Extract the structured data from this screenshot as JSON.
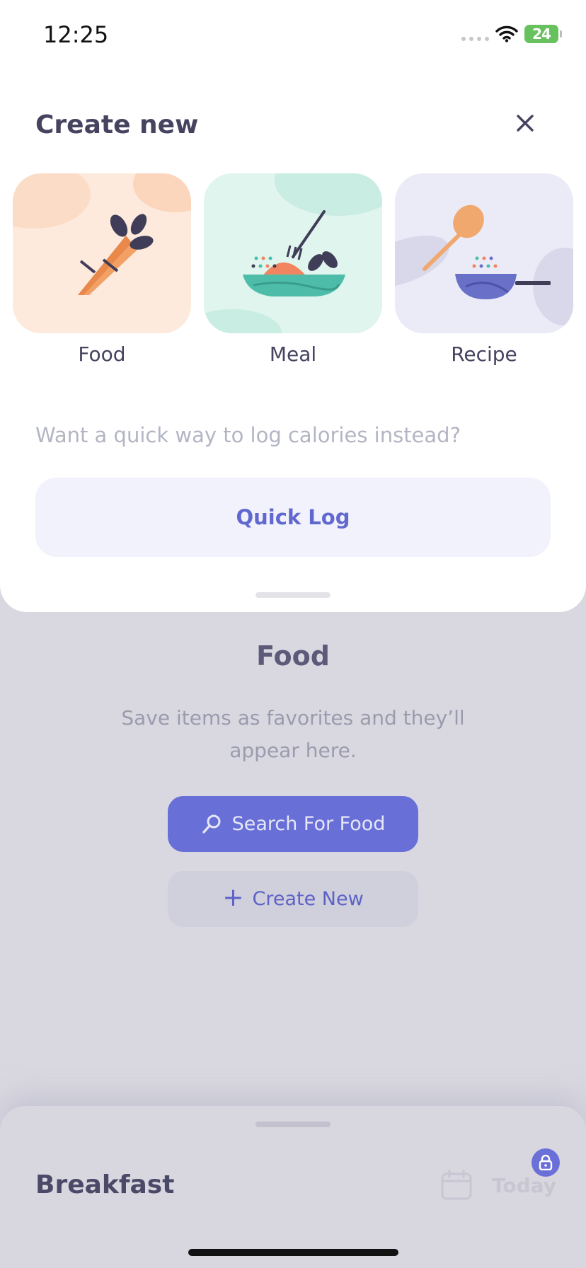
{
  "status_bar": {
    "time": "12:25",
    "battery": "24"
  },
  "modal": {
    "title": "Create new",
    "options": [
      {
        "label": "Food",
        "icon": "carrot-icon"
      },
      {
        "label": "Meal",
        "icon": "salad-bowl-icon"
      },
      {
        "label": "Recipe",
        "icon": "pan-spoon-icon"
      }
    ],
    "quick_prompt": "Want a quick way to log calories instead?",
    "quick_log_label": "Quick Log"
  },
  "background": {
    "title": "Food",
    "description": "Save items as favorites and they’ll appear here.",
    "search_label": "Search For Food",
    "create_label": "Create New"
  },
  "bottom_sheet": {
    "meal": "Breakfast",
    "date_label": "Today"
  },
  "colors": {
    "accent": "#6870d8",
    "text_dark": "#45435f",
    "food_card": "#fdeadd",
    "meal_card": "#dff5ee",
    "recipe_card": "#ebebf7"
  }
}
